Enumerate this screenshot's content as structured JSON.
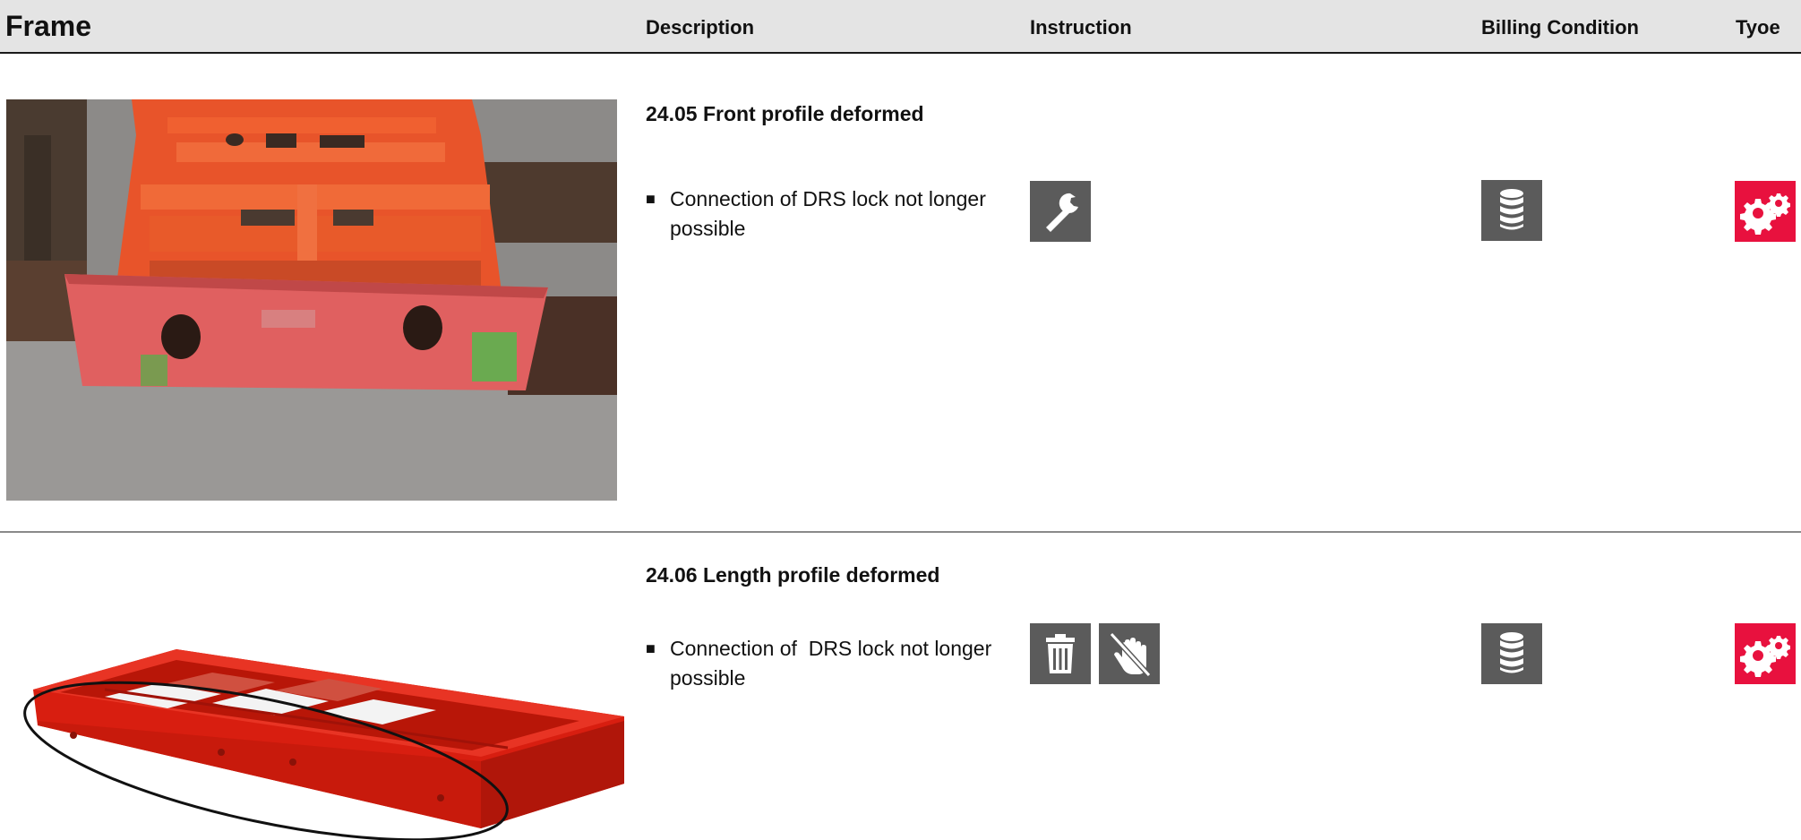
{
  "header": {
    "frame": "Frame",
    "description": "Description",
    "instruction": "Instruction",
    "billing_condition": "Billing Condition",
    "type": "Tyoe"
  },
  "rows": [
    {
      "title": "24.05 Front profile deformed",
      "bullet_marker": "■",
      "bullet_text": "Connection of DRS lock not longer possible",
      "instruction_icons": [
        "wrench-icon"
      ],
      "billing_icon": "database-icon",
      "type_icon": "gears-icon"
    },
    {
      "title": "24.06 Length profile deformed",
      "bullet_marker": "■",
      "bullet_text": "Connection of  DRS lock not longer possible",
      "instruction_icons": [
        "trash-icon",
        "no-touch-hand-icon"
      ],
      "billing_icon": "database-icon",
      "type_icon": "gears-icon"
    }
  ],
  "colors": {
    "icon_gray": "#5b5b5b",
    "type_red": "#e8113e",
    "header_bg": "#e4e4e4"
  }
}
